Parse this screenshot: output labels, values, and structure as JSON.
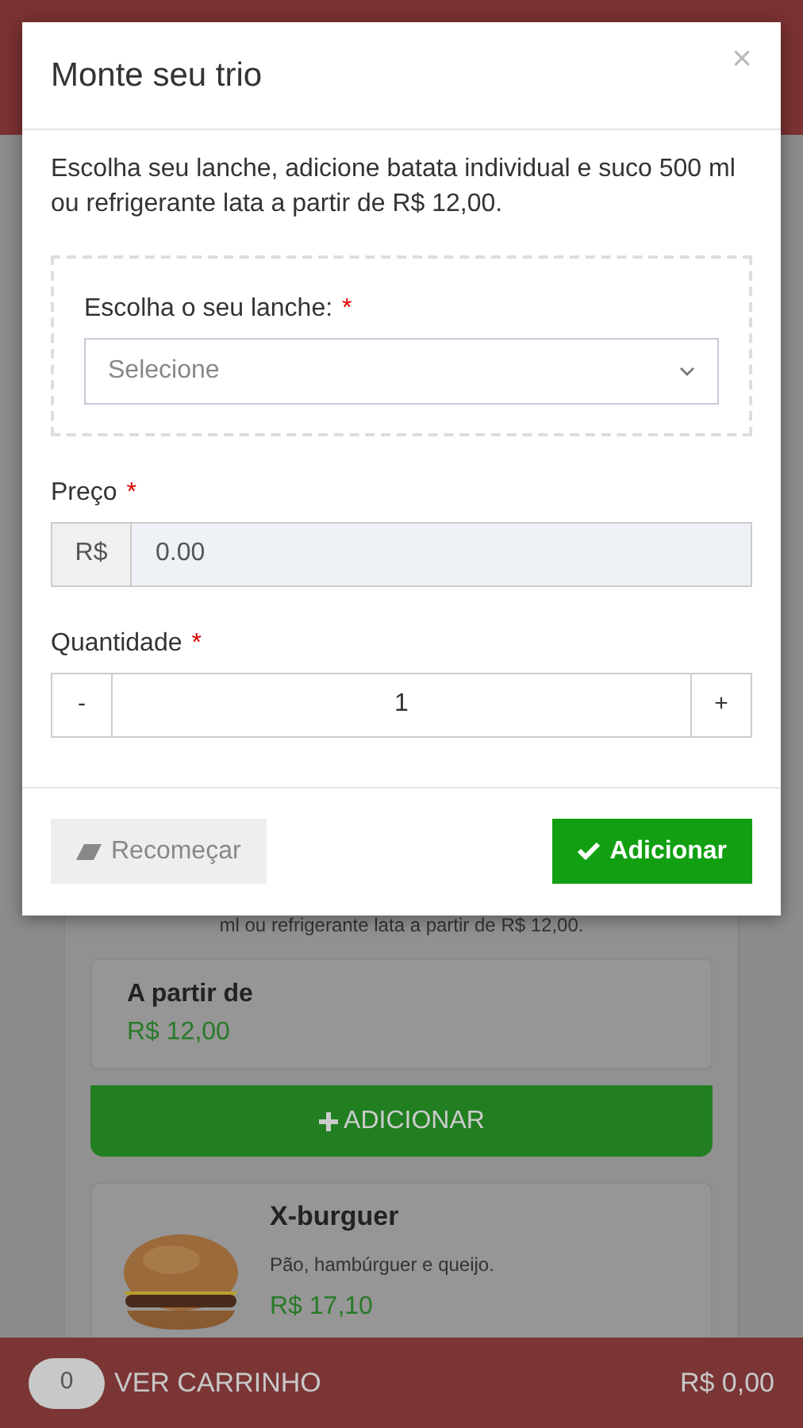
{
  "modal": {
    "title": "Monte seu trio",
    "close": "×",
    "description": "Escolha seu lanche, adicione batata individual e suco 500 ml ou refrigerante lata a partir de R$ 12,00.",
    "fields": [
      {
        "kind": "select",
        "label": "Escolha o seu lanche:",
        "required_mark": "*",
        "placeholder": "Selecione"
      },
      {
        "kind": "price",
        "label": "Preço",
        "required_mark": "*",
        "prefix": "R$",
        "value": "0.00",
        "disabled": true
      },
      {
        "kind": "quantity",
        "label": "Quantidade",
        "required_mark": "*",
        "minus": "-",
        "value": "1",
        "plus": "+"
      }
    ],
    "buttons": [
      {
        "kind": "secondary",
        "label": "Recomeçar"
      },
      {
        "kind": "primary",
        "label": "Adicionar"
      }
    ]
  },
  "background": {
    "offer_text": "ml ou refrigerante lata a partir de R$ 12,00.",
    "price_label": "A partir de",
    "price": "R$ 12,00",
    "add_button": "ADICIONAR",
    "products": [
      {
        "name": "X-burguer",
        "description": "Pão, hambúrguer e queijo.",
        "price": "R$ 17,10"
      }
    ]
  },
  "cart_bar": {
    "count": "0",
    "label": "VER CARRINHO",
    "total": "R$ 0,00"
  }
}
